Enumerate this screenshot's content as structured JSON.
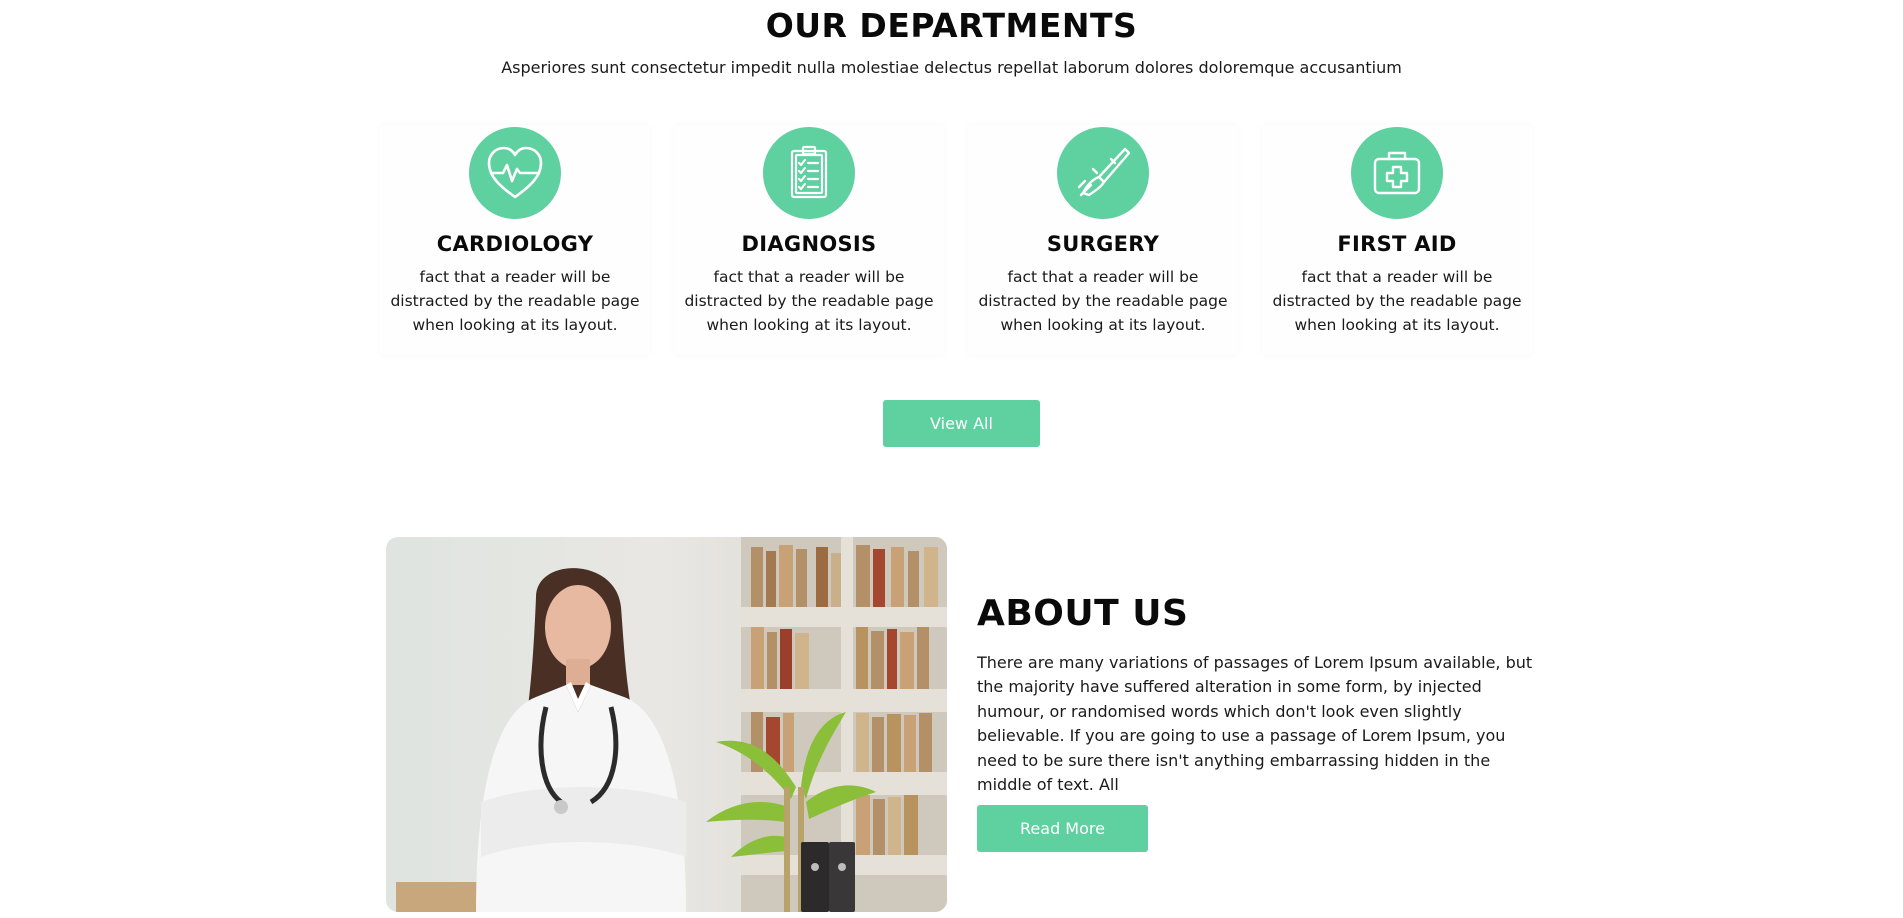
{
  "departments": {
    "title": "OUR DEPARTMENTS",
    "subtitle": "Asperiores sunt consectetur impedit nulla molestiae delectus repellat laborum dolores doloremque accusantium",
    "cards": [
      {
        "icon": "heart-pulse-icon",
        "title": "CARDIOLOGY",
        "text": "fact that a reader will be distracted by the readable page when looking at its layout."
      },
      {
        "icon": "clipboard-checklist-icon",
        "title": "DIAGNOSIS",
        "text": "fact that a reader will be distracted by the readable page when looking at its layout."
      },
      {
        "icon": "scalpel-hand-icon",
        "title": "SURGERY",
        "text": "fact that a reader will be distracted by the readable page when looking at its layout."
      },
      {
        "icon": "first-aid-kit-icon",
        "title": "FIRST AID",
        "text": "fact that a reader will be distracted by the readable page when looking at its layout."
      }
    ],
    "view_all_label": "View All"
  },
  "about": {
    "title": "ABOUT US",
    "text": "There are many variations of passages of Lorem Ipsum available, but the majority have suffered alteration in some form, by injected humour, or randomised words which don't look even slightly believable. If you are going to use a passage of Lorem Ipsum, you need to be sure there isn't anything embarrassing hidden in the middle of text. All",
    "read_more_label": "Read More",
    "image": "doctor-photo"
  },
  "colors": {
    "accent": "#5fd0a0",
    "text": "#111111",
    "background": "#ffffff"
  }
}
